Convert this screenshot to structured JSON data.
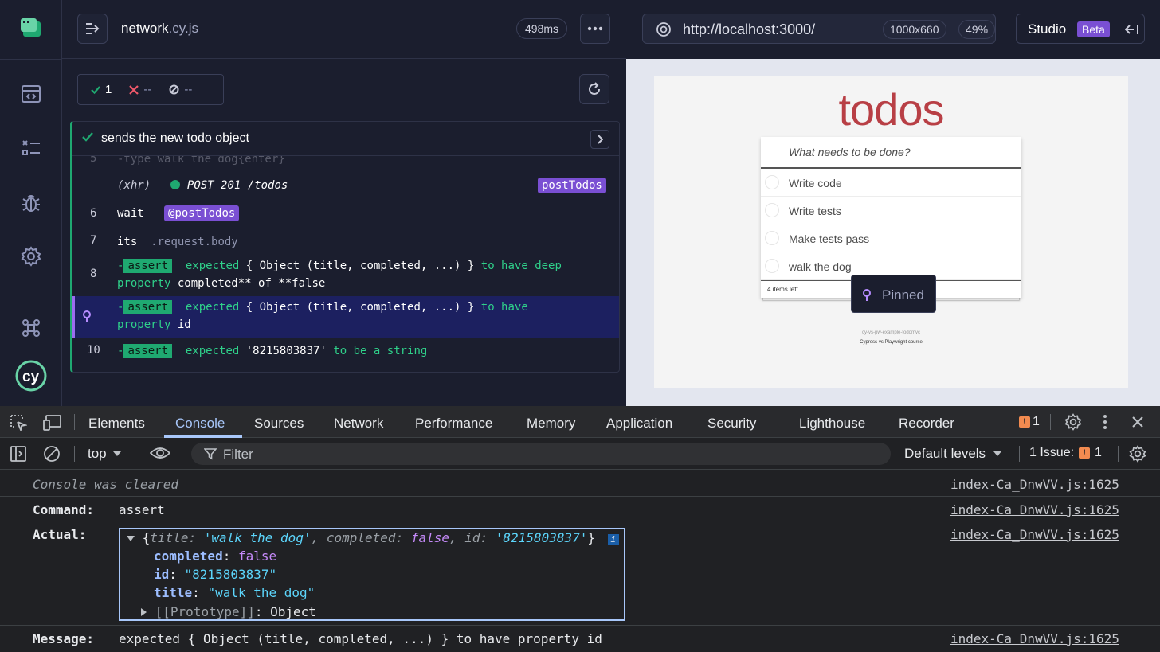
{
  "reporter": {
    "spec_name": "network",
    "spec_ext": ".cy.js",
    "duration": "498ms",
    "stats": {
      "passed": "1",
      "failed": "--",
      "pending": "--"
    },
    "test_title": "sends the new todo object",
    "commands": [
      {
        "num": "5",
        "text": "-type  walk the dog{enter}"
      },
      {
        "num": "",
        "xhr": "(xhr)",
        "method": "POST 201 /todos",
        "alias": "postTodos"
      },
      {
        "num": "6",
        "name": "wait",
        "alias": "@postTodos"
      },
      {
        "num": "7",
        "name": "its",
        "arg": ".request.body"
      },
      {
        "num": "8",
        "kw": "assert",
        "pre": "-",
        "line1_a": "expected",
        "line1_b": "{ Object (title, completed, ...) }",
        "line1_c": "to have deep",
        "line2_a": "property",
        "line2_b": "completed** of **false"
      },
      {
        "num": "",
        "kw": "assert",
        "pre": "-",
        "line1_a": "expected",
        "line1_b": "{ Object (title, completed, ...) }",
        "line1_c": "to have",
        "line2_a": "property",
        "line2_b": "id"
      },
      {
        "num": "10",
        "kw": "assert",
        "pre": "-",
        "line1_a": "expected",
        "line1_b": "'8215803837'",
        "line1_c": "to be a string"
      }
    ]
  },
  "preview": {
    "url": "http://localhost:3000/",
    "viewport": "1000x660",
    "zoom": "49%",
    "studio_label": "Studio",
    "beta_label": "Beta",
    "app_title": "todos",
    "new_todo_placeholder": "What needs to be done?",
    "todos": [
      "Write code",
      "Write tests",
      "Make tests pass",
      "walk the dog"
    ],
    "items_left": "4 items left",
    "pinned_label": "Pinned",
    "footer_line1": "cy-vs-pw-example-todomvc",
    "footer_line2": "Cypress vs Playwright course"
  },
  "devtools": {
    "tabs": [
      "Elements",
      "Console",
      "Sources",
      "Network",
      "Performance",
      "Memory",
      "Application",
      "Security",
      "Lighthouse",
      "Recorder"
    ],
    "active_tab": "Console",
    "issue_count": "1",
    "context": "top",
    "filter_placeholder": "Filter",
    "levels": "Default levels",
    "issues_label": "1 Issue:",
    "issues_num": "1",
    "logs": {
      "cleared": "Console was cleared",
      "command_key": "Command:",
      "command_val": "assert",
      "actual_key": "Actual:",
      "message_key": "Message:",
      "message_val": "expected { Object (title, completed, ...) } to have property id",
      "source": "index-Ca_DnwVV.js:1625"
    },
    "object": {
      "summary_title_key": "title",
      "summary_title_val": "'walk the dog'",
      "summary_completed_key": "completed",
      "summary_completed_val": "false",
      "summary_id_key": "id",
      "summary_id_val": "'8215803837'",
      "completed_key": "completed",
      "completed_val": "false",
      "id_key": "id",
      "id_val": "\"8215803837\"",
      "title_key": "title",
      "title_val": "\"walk the dog\"",
      "proto_key": "[[Prototype]]",
      "proto_val": "Object"
    }
  },
  "colors": {
    "pass": "#1fa971",
    "fail": "#f0586a",
    "alias": "#7a4fd3",
    "accent": "#a8c7fa",
    "todo_red": "#b83f45"
  }
}
